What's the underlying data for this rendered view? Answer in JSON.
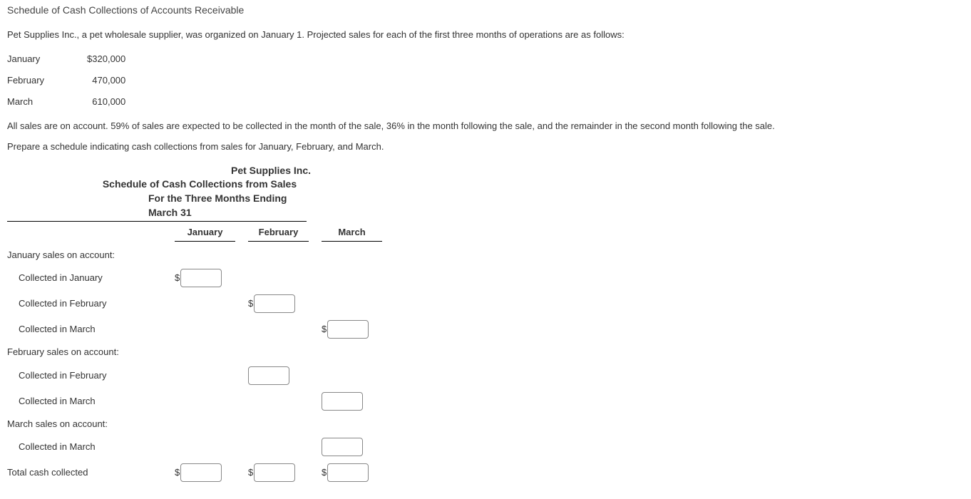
{
  "title": "Schedule of Cash Collections of Accounts Receivable",
  "intro": "Pet Supplies Inc., a pet wholesale supplier, was organized on January 1. Projected sales for each of the first three months of operations are as follows:",
  "sales": {
    "rows": [
      {
        "month": "January",
        "amount": "$320,000"
      },
      {
        "month": "February",
        "amount": "470,000"
      },
      {
        "month": "March",
        "amount": "610,000"
      }
    ]
  },
  "policy": "All sales are on account. 59% of sales are expected to be collected in the month of the sale, 36% in the month following the sale, and the remainder in the second month following the sale.",
  "instruction": "Prepare a schedule indicating cash collections from sales for January, February, and March.",
  "schedule": {
    "company": "Pet Supplies Inc.",
    "report": "Schedule of Cash Collections from Sales",
    "period": "For the Three Months Ending March 31",
    "columns": {
      "c1": "January",
      "c2": "February",
      "c3": "March"
    },
    "rows": {
      "jan_header": "January sales on account:",
      "jan_collected_jan": "Collected in January",
      "jan_collected_feb": "Collected in February",
      "jan_collected_mar": "Collected in March",
      "feb_header": "February sales on account:",
      "feb_collected_feb": "Collected in February",
      "feb_collected_mar": "Collected in March",
      "mar_header": "March sales on account:",
      "mar_collected_mar": "Collected in March",
      "total": "Total cash collected"
    },
    "dollar": "$"
  }
}
